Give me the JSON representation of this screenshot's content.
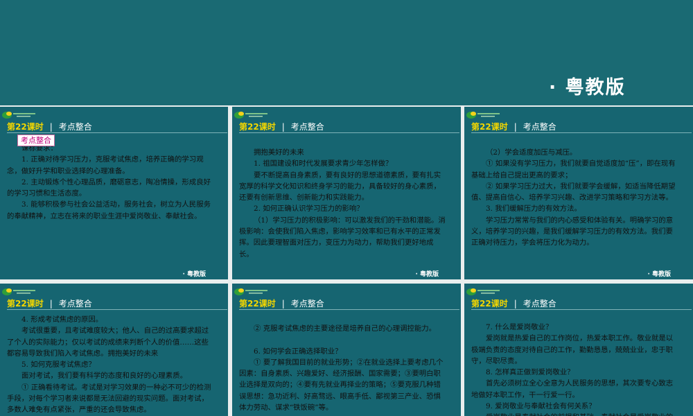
{
  "brand_top": "· 粤教版",
  "slide_header": {
    "lesson": "第22课时",
    "sep": "|",
    "topic": "考点整合"
  },
  "slide_footer": "· 粤教版",
  "slides": [
    {
      "tag": "考点整合",
      "paragraphs": [
        "课标要求：",
        "1. 正确对待学习压力，克服考试焦虑，培养正确的学习观念，做好升学和职业选择的心理准备。",
        "2. 主动锻炼个性心理品质，磨砺意志，陶冶情操，形成良好的学习习惯和生活态度。",
        "3. 能够积极参与社会公益活动，服务社会，树立为人民服务的奉献精神，立志在将来的职业生涯中爱岗敬业、奉献社会。"
      ]
    },
    {
      "tag": "",
      "paragraphs": [
        "拥抱美好的未来",
        "1. 祖国建设和时代发展要求青少年怎样做？",
        "要不断提高自身素质，要有良好的思想道德素质，要有扎实宽厚的科学文化知识和终身学习的能力，具备较好的身心素质，还要有创新思维、创新能力和实践能力。",
        "2. 如何正确认识学习压力的影响？",
        "（1）学习压力的积极影响：可以激发我们的干劲和潜能。消极影响：会使我们陷入焦虑，影响学习效率和已有水平的正常发挥。因此要理智面对压力，变压力为动力，帮助我们更好地成长。"
      ]
    },
    {
      "tag": "",
      "paragraphs": [
        "（2）学会适度加压与减压。",
        "① 如果没有学习压力，我们就要自觉适度加“压”，即在现有基础上给自己提出更高的要求；",
        "② 如果学习压力过大，我们就要学会缓解，如适当降低期望值、提高自信心、培养学习兴趣、改进学习策略和学习方法等。",
        "3. 我们缓解压力的有效方法。",
        "学习压力常常与我们的内心感受和体验有关。明确学习的意义，培养学习的兴趣，是我们缓解学习压力的有效方法。我们要正确对待压力，学会将压力化为动力。"
      ]
    },
    {
      "tag": "",
      "paragraphs": [
        "4. 形成考试焦虑的原因。",
        "考试很重要，且考试难度较大；他人、自己的过高要求超过了个人的实际能力；仅以考试的成绩来判断个人的价值……这些都容易导致我们陷入考试焦虑。拥抱美好的未来",
        "5. 如何克服考试焦虑？",
        "面对考试，我们要有科学的态度和良好的心理素质。",
        "① 正确看待考试。考试是对学习效果的一种必不可少的检测手段，对每个学习者来说都是无法回避的现实问题。面对考试，多数人难免有点紧张，严重的还会导致焦虑。"
      ]
    },
    {
      "tag": "",
      "paragraphs": [
        "② 克服考试焦虑的主要途径是培养自己的心理调控能力。",
        "",
        "6. 如何学会正确选择职业？",
        "① 要了解我国目前的就业形势；②在就业选择上要考虑几个因素：自身素质、兴趣爱好、经济报酬、国家需要；③要明白职业选择是双向的；④要有先就业再择业的策略；⑤要克服几种错误思想：急功近利、好高骛远、眼高手低、鄙视第三产业、恐惧体力劳动、谋求“铁饭碗”等。"
      ]
    },
    {
      "tag": "",
      "paragraphs": [
        "7. 什么是爱岗敬业？",
        "爱岗就是热爱自己的工作岗位，热爱本职工作。敬业就是以极端负责的态度对待自己的工作，勤勤恳恳，兢兢业业，忠于职守，尽职尽责。",
        "8. 怎样真正做到爱岗敬业？",
        "首先必须树立全心全意为人民服务的思想，其次要专心致志地做好本职工作，干一行爱一行。",
        "9. 爱岗敬业与奉献社会有何关系？",
        "爱岗敬业是奉献社会的前提和基础，奉献社会是爱岗敬业的最终归宿。"
      ]
    }
  ]
}
